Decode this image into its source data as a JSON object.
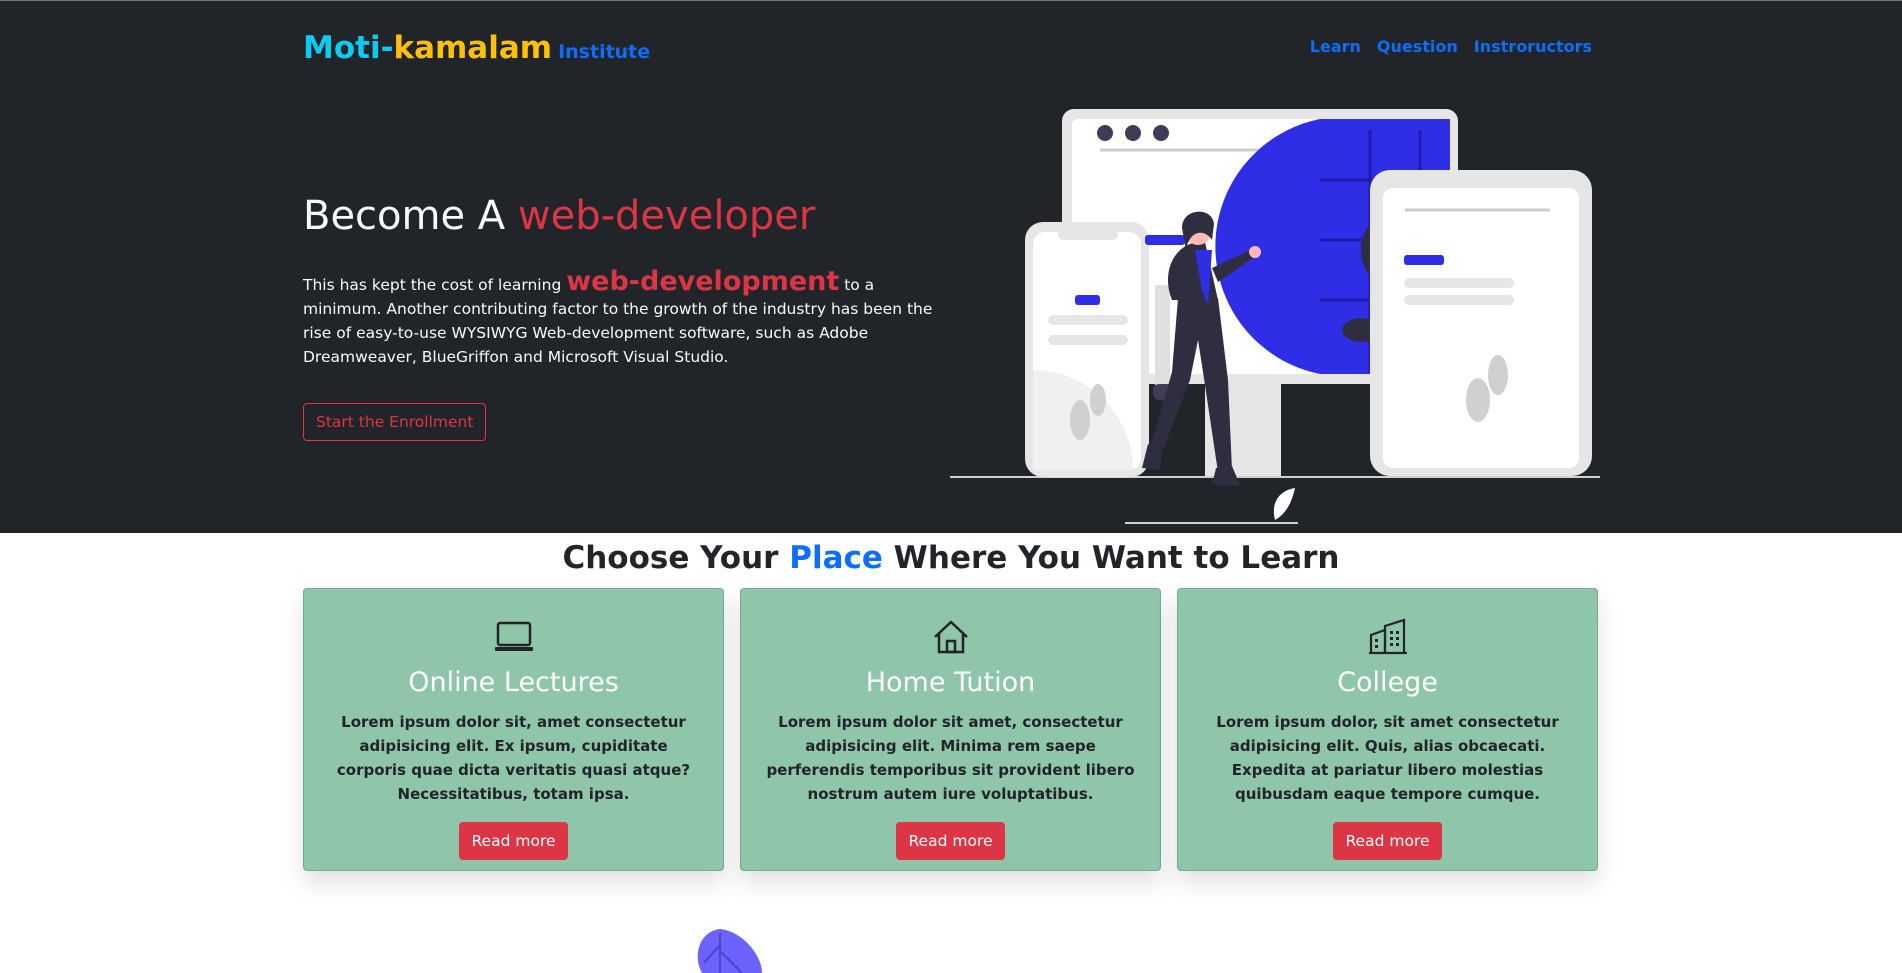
{
  "brand": {
    "part1": "Moti-",
    "part2": "kamalam",
    "part3": "Institute"
  },
  "nav": {
    "items": [
      "Learn",
      "Question",
      "Instroructors"
    ]
  },
  "hero": {
    "title_prefix": "Become A ",
    "title_accent": "web-developer",
    "text_before": "This has kept the cost of learning ",
    "text_highlight": "web-development",
    "text_after": " to a minimum. Another contributing factor to the growth of the industry has been the rise of easy-to-use WYSIWYG Web-development software, such as Adobe Dreamweaver, BlueGriffon and Microsoft Visual Studio.",
    "button_label": "Start the Enrollment"
  },
  "section": {
    "title_prefix": "Choose Your ",
    "title_accent": "Place",
    "title_suffix": " Where You Want to Learn"
  },
  "cards": [
    {
      "icon": "laptop-icon",
      "title": "Online Lectures",
      "text": "Lorem ipsum dolor sit, amet consectetur adipisicing elit. Ex ipsum, cupiditate corporis quae dicta veritatis quasi atque? Necessitatibus, totam ipsa.",
      "button": "Read more"
    },
    {
      "icon": "house-icon",
      "title": "Home Tution",
      "text": "Lorem ipsum dolor sit amet, consectetur adipisicing elit. Minima rem saepe perferendis temporibus sit provident libero nostrum autem iure voluptatibus.",
      "button": "Read more"
    },
    {
      "icon": "building-icon",
      "title": "College",
      "text": "Lorem ipsum dolor, sit amet consectetur adipisicing elit. Quis, alias obcaecati. Expedita at pariatur libero molestias quibusdam eaque tempore cumque.",
      "button": "Read more"
    }
  ],
  "colors": {
    "dark": "#212529",
    "accent_red": "#dc3545",
    "accent_blue": "#0d6efd",
    "cyan": "#0dcaf0",
    "yellow": "#ffc107",
    "card_bg": "#8fc5a9",
    "illustration_blue": "#2f2ee6"
  }
}
